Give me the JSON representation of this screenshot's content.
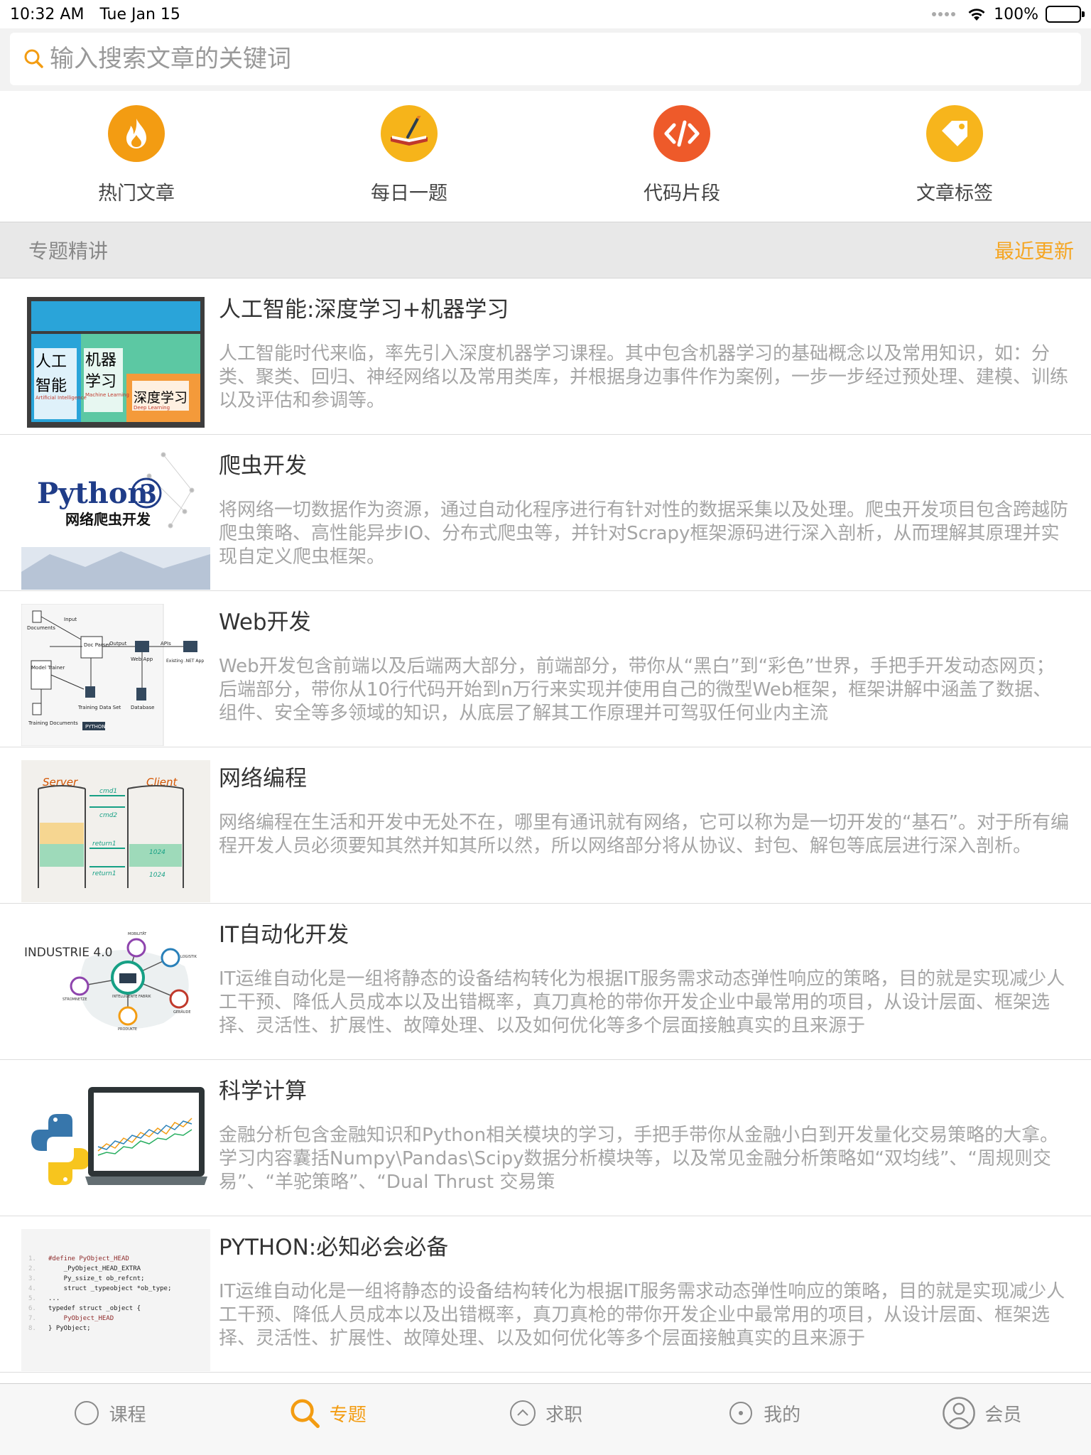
{
  "status_bar": {
    "time": "10:32 AM",
    "date": "Tue Jan 15",
    "battery": "100%",
    "battery_level": 1.0
  },
  "search": {
    "placeholder": "输入搜索文章的关键词",
    "value": ""
  },
  "quick_menu": [
    {
      "label": "热门文章",
      "icon": "flame-icon",
      "color": "#f39c12"
    },
    {
      "label": "每日一题",
      "icon": "book-pen-icon",
      "color": "#f6b41a"
    },
    {
      "label": "代码片段",
      "icon": "code-icon",
      "color": "#ee5a2a"
    },
    {
      "label": "文章标签",
      "icon": "tag-icon",
      "color": "#f7b51c"
    }
  ],
  "section": {
    "title": "专题精讲",
    "link": "最近更新"
  },
  "topics": [
    {
      "title": "人工智能:深度学习+机器学习",
      "desc": "人工智能时代来临，率先引入深度机器学习课程。其中包含机器学习的基础概念以及常用知识，如：分类、聚类、回归、神经网络以及常用类库，并根据身边事件作为案例，一步一步经过预处理、建模、训练以及评估和参调等。",
      "thumb": {
        "t1": "人工",
        "t2": "智能",
        "t3": "机器",
        "t4": "学习",
        "t5": "深度学习",
        "s1": "Artificial Intelligence",
        "s2": "Machine Learning",
        "s3": "Deep Learning"
      }
    },
    {
      "title": "爬虫开发",
      "desc": "将网络一切数据作为资源，通过自动化程序进行有针对性的数据采集以及处理。爬虫开发项目包含跨越防爬虫策略、高性能异步IO、分布式爬虫等，并针对Scrapy框架源码进行深入剖析，从而理解其原理并实现自定义爬虫框架。",
      "thumb": {
        "t1": "Python",
        "t2": "3",
        "t3": "网络爬虫开发"
      }
    },
    {
      "title": "Web开发",
      "desc": "Web开发包含前端以及后端两大部分，前端部分，带你从“黑白”到“彩色”世界，手把手开发动态网页；后端部分，带你从10行代码开始到n万行来实现并使用自己的微型Web框架，框架讲解中涵盖了数据、组件、安全等多领域的知识，从底层了解其工作原理并可驾驭任何业内主流",
      "thumb": {
        "l1": "Documents",
        "l2": "Input",
        "l3": "Doc Parser",
        "l4": "Output",
        "l5": "Web App",
        "l6": "APIs",
        "l7": "Existing .NET App",
        "l8": "Model Trainer",
        "l9": "Training Data Set",
        "l10": "Database",
        "l11": "Training Documents",
        "l12": "PYTHON"
      }
    },
    {
      "title": "网络编程",
      "desc": "网络编程在生活和开发中无处不在，哪里有通讯就有网络，它可以称为是一切开发的“基石”。对于所有编程开发人员必须要知其然并知其所以然，所以网络部分将从协议、封包、解包等底层进行深入剖析。",
      "thumb": {
        "server": "Server",
        "client": "Client",
        "c1": "cmd1",
        "c2": "cmd2",
        "r1": "return1",
        "r2": "return1",
        "n1": "1024",
        "n2": "1024"
      }
    },
    {
      "title": "IT自动化开发",
      "desc": "IT运维自动化是一组将静态的设备结构转化为根据IT服务需求动态弹性响应的策略，目的就是实现减少人工干预、降低人员成本以及出错概率，真刀真枪的带你开发企业中最常用的项目，从设计层面、框架选择、灵活性、扩展性、故障处理、以及如何优化等多个层面接触真实的且来源于",
      "thumb": {
        "t1": "INDUSTRIE 4.0",
        "l1": "MOBILITÄT",
        "l2": "LOGISTIK",
        "l3": "STROMNETZE",
        "l4": "INTELLIGENTE FABRIK",
        "l5": "GEBÄUDE",
        "l6": "PRODUKTE"
      }
    },
    {
      "title": "科学计算",
      "desc": "金融分析包含金融知识和Python相关模块的学习，手把手带你从金融小白到开发量化交易策略的大拿。学习内容囊括Numpy\\Pandas\\Scipy数据分析模块等，以及常见金融分析策略如“双均线”、“周规则交易”、“羊驼策略”、“Dual Thrust 交易策",
      "thumb": {}
    },
    {
      "title": "PYTHON:必知必会必备",
      "desc": "IT运维自动化是一组将静态的设备结构转化为根据IT服务需求动态弹性响应的策略，目的就是实现减少人工干预、降低人员成本以及出错概率，真刀真枪的带你开发企业中最常用的项目，从设计层面、框架选择、灵活性、扩展性、故障处理、以及如何优化等多个层面接触真实的且来源于",
      "thumb": {
        "code": [
          "#define PyObject_HEAD",
          "    _PyObject_HEAD_EXTRA",
          "    Py_ssize_t ob_refcnt;",
          "    struct _typeobject *ob_type;",
          "...",
          "typedef struct _object {",
          "    PyObject_HEAD",
          "} PyObject;"
        ]
      }
    }
  ],
  "tabs": [
    {
      "label": "课程",
      "icon": "circle-icon",
      "active": false
    },
    {
      "label": "专题",
      "icon": "search-icon",
      "active": true
    },
    {
      "label": "求职",
      "icon": "chevron-up-circle-icon",
      "active": false
    },
    {
      "label": "我的",
      "icon": "dot-circle-icon",
      "active": false
    },
    {
      "label": "会员",
      "icon": "user-circle-icon",
      "active": false
    }
  ],
  "colors": {
    "accent": "#f39c12",
    "section_bg": "#e8e8e8",
    "desc_text": "#a5a5a5"
  }
}
